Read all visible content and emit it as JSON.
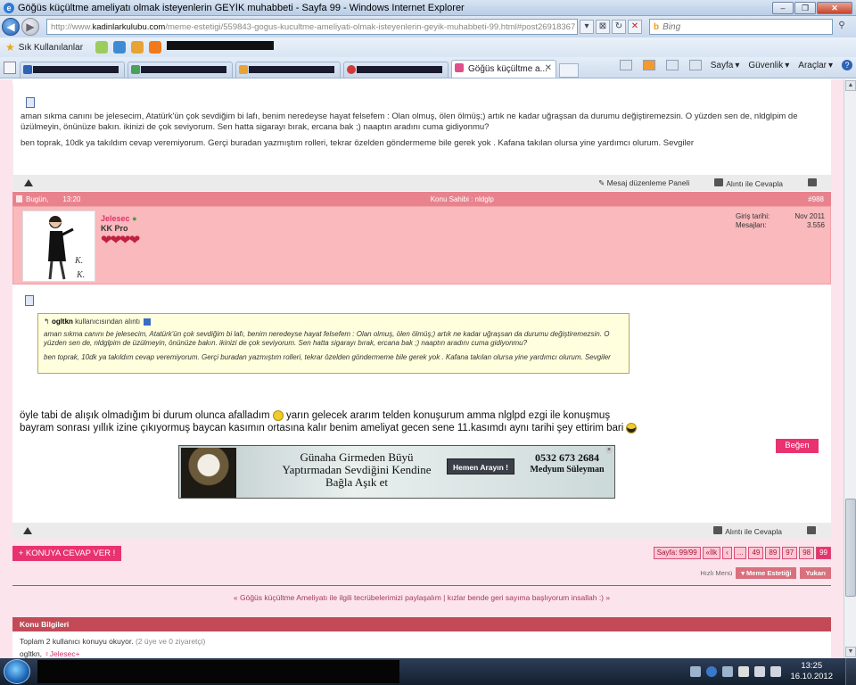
{
  "browser": {
    "title": "Göğüs küçültme ameliyatı olmak isteyenlerin GEYİK muhabbeti - Sayfa 99 - Windows Internet Explorer",
    "address_prefix": "http://www.",
    "address_host": "kadinlarkulubu.com",
    "address_rest": "/meme-estetigi/559843-gogus-kucultme-ameliyati-olmak-isteyenlerin-geyik-muhabbeti-99.html#post26918367",
    "search_placeholder": "Bing",
    "favorites_label": "Sık Kullanılanlar",
    "active_tab": "Göğüs küçültme a...",
    "cmd_sayfa": "Sayfa",
    "cmd_guvenlik": "Güvenlik",
    "cmd_araclar": "Araçlar"
  },
  "post1": {
    "para1": "aman sıkma canını be jelesecim, Atatürk'ün çok sevdiğim bi lafı, benim neredeyse hayat felsefem : Olan olmuş, ölen ölmüş;) artık ne kadar uğraşsan da durumu değiştiremezsin. O yüzden sen de, nldglpim de üzülmeyin, önünüze bakın. ikinizi de çok seviyorum. Sen hatta sigarayı bırak, ercana bak ;) naaptın aradını cuma gidiyonmu?",
    "para2": "ben toprak, 10dk ya takıldım cevap veremiyorum. Gerçi buradan yazmıştım rolleri, tekrar özelden göndermeme bile gerek yok . Kafana takılan olursa yine yardımcı olurum. Sevgiler",
    "edit_label": "Mesaj düzenleme Paneli",
    "quote_label": "Alıntı ile Cevapla"
  },
  "post2": {
    "date": "Bugün,",
    "time": "13:20",
    "owner": "Konu Sahibi : nldglp",
    "number": "#988",
    "username": "Jelesec",
    "rank": "KK Pro",
    "hearts": "❤❤❤❤",
    "join_label": "Giriş tarihi:",
    "join_value": "Nov 2011",
    "posts_label": "Mesajları:",
    "posts_value": "3.556",
    "quote_author": "ogltkn",
    "quote_suffix": "kullanıcısından alıntı",
    "quote_p1": "aman sıkma canını be jelesecim, Atatürk'ün çok sevdiğim bi lafı, benim neredeyse hayat felsefem : Olan olmuş, ölen ölmüş;) artık ne kadar uğraşsan da durumu değiştiremezsin. O yüzden sen de, nldglpim de üzülmeyin, önünüze bakın. ikinizi de çok seviyorum. Sen hatta sigarayı bırak, ercana bak ;) naaptın aradını cuma gidiyonmu?",
    "quote_p2": "ben toprak, 10dk ya takıldım cevap veremiyorum. Gerçi buradan yazmıştım rolleri, tekrar özelden göndermeme bile gerek yok . Kafana takılan olursa yine yardımcı olurum. Sevgiler",
    "reply_l1a": "öyle tabi de alışık olmadığım bi durum olunca afalladım ",
    "reply_l1b": " yarın gelecek ararım telden konuşurum amma nlglpd ezgi ile konuşmuş",
    "reply_l2": "bayram sonrası yıllık izine çıkıyormuş baycan kasımın ortasına kalır benim ameliyat gecen sene 11.kasımdı aynı tarihi şey ettirim bari ",
    "like_label": "Beğen",
    "quote_label": "Alıntı ile Cevapla"
  },
  "ad": {
    "headline": "Günaha Girmeden Büyü Yaptırmadan Sevdiğini Kendine Bağla Aşık et",
    "cta": "Hemen Arayın !",
    "phone": "0532 673 2684",
    "name": "Medyum Süleyman"
  },
  "controls": {
    "reply_button": "+ KONUYA CEVAP VER !",
    "pager": [
      "Sayfa: 99/99",
      "«İlk",
      "‹",
      "...",
      "49",
      "89",
      "97",
      "98",
      "99"
    ],
    "quicknav_label": "Hızlı Menü",
    "quicknav_forum": "Meme Estetiği",
    "quicknav_top": "Yukarı",
    "prev_link": "« Göğüs küçültme Ameliyatı ile ilgili tecrübelerimizi paylaşalım",
    "next_link": "kızlar bende geri sayıma başlıyorum insallah :) »"
  },
  "thread_info": {
    "header": "Konu Bilgileri",
    "readers": "Toplam 2 kullanıcı konuyu okuyor.",
    "readers_detail": "(2 üye ve 0 ziyaretçi)",
    "user1": "ogltkn,",
    "user2": "Jelesec+"
  },
  "taskbar": {
    "time": "13:25",
    "date": "16.10.2012"
  }
}
